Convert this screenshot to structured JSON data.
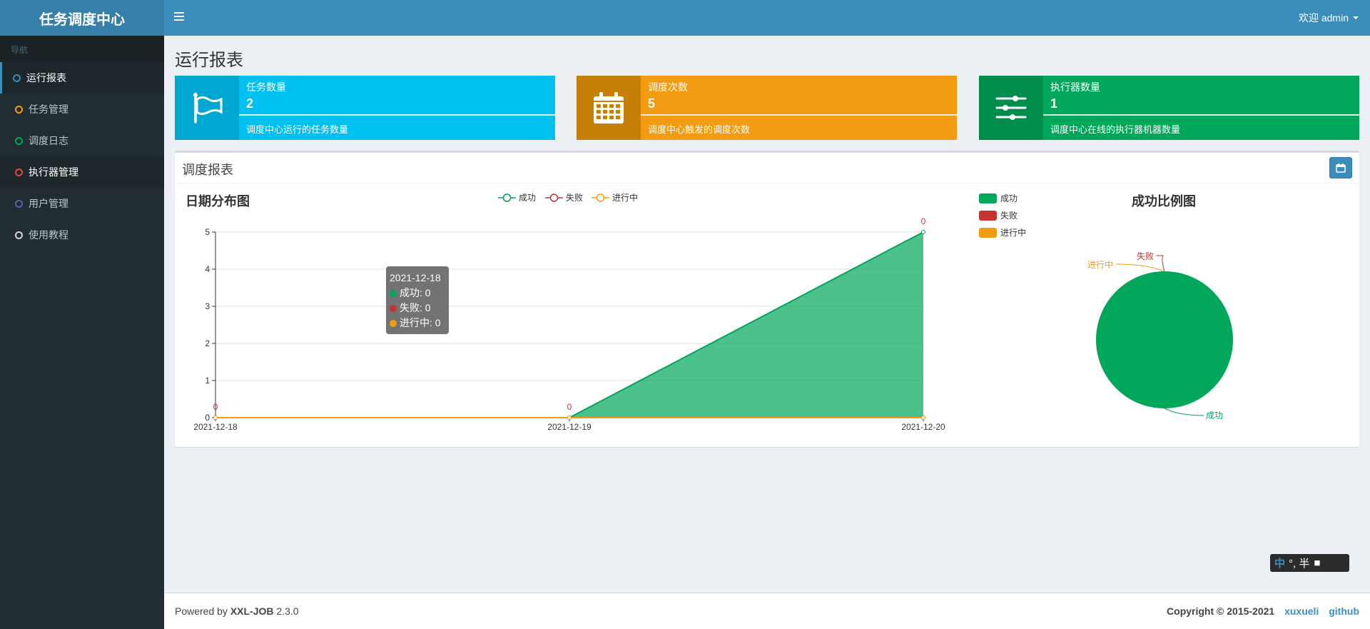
{
  "app": {
    "logo": "任务调度中心"
  },
  "header": {
    "user": "欢迎 admin"
  },
  "sidebar": {
    "header": "导航",
    "items": [
      {
        "label": "运行报表",
        "color": "#3c8dbc"
      },
      {
        "label": "任务管理",
        "color": "#f39c12"
      },
      {
        "label": "调度日志",
        "color": "#00a65a"
      },
      {
        "label": "执行器管理",
        "color": "#dd4b39"
      },
      {
        "label": "用户管理",
        "color": "#605ca8"
      },
      {
        "label": "使用教程",
        "color": "#d2d6de"
      }
    ]
  },
  "page": {
    "title": "运行报表"
  },
  "stats": [
    {
      "label": "任务数量",
      "value": "2",
      "desc": "调度中心运行的任务数量",
      "icon": "flag-icon",
      "color": "#00c0ef",
      "icon_bg": "#00a7d0"
    },
    {
      "label": "调度次数",
      "value": "5",
      "desc": "调度中心触发的调度次数",
      "icon": "calendar-icon",
      "color": "#f39c12",
      "icon_bg": "#c87f0a"
    },
    {
      "label": "执行器数量",
      "value": "1",
      "desc": "调度中心在线的执行器机器数量",
      "icon": "sliders-icon",
      "color": "#00a65a",
      "icon_bg": "#008d4c"
    }
  ],
  "report": {
    "title": "调度报表"
  },
  "line_chart": {
    "title": "日期分布图"
  },
  "pie_chart": {
    "title": "成功比例图"
  },
  "tooltip": {
    "date": "2021-12-18",
    "lines": [
      "成功: 0",
      "失败: 0",
      "进行中: 0"
    ]
  },
  "chart_data": [
    {
      "type": "area",
      "title": "日期分布图",
      "categories": [
        "2021-12-18",
        "2021-12-19",
        "2021-12-20"
      ],
      "ylim": [
        0,
        5
      ],
      "yticks": [
        0,
        1,
        2,
        3,
        4,
        5
      ],
      "legend": "top-center",
      "series": [
        {
          "name": "成功",
          "color": "#00a65a",
          "values": [
            0,
            0,
            5
          ]
        },
        {
          "name": "失败",
          "color": "#c23531",
          "values": [
            0,
            0,
            0
          ]
        },
        {
          "name": "进行中",
          "color": "#f39c12",
          "values": [
            0,
            0,
            0
          ]
        }
      ],
      "data_labels": [
        "0",
        "0",
        "0"
      ]
    },
    {
      "type": "pie",
      "title": "成功比例图",
      "legend": "left",
      "slices": [
        {
          "name": "成功",
          "color": "#00a65a",
          "value": 5
        },
        {
          "name": "失败",
          "color": "#c23531",
          "value": 0
        },
        {
          "name": "进行中",
          "color": "#f39c12",
          "value": 0
        }
      ]
    }
  ],
  "ime": {
    "text": "°, 半"
  },
  "footer": {
    "powered_prefix": "Powered by ",
    "brand": "XXL-JOB",
    "version": " 2.3.0",
    "copyright": "Copyright © 2015-2021",
    "link1": "xuxueli",
    "link2": "github"
  }
}
